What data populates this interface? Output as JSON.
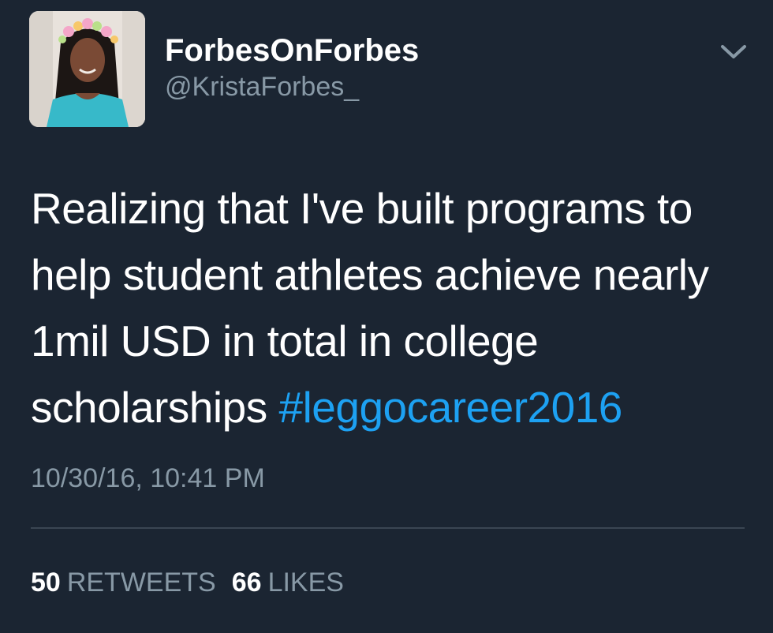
{
  "user": {
    "display_name": "ForbesOnForbes",
    "handle": "@KristaForbes_",
    "avatar_icon": "profile-photo-flower-crown"
  },
  "tweet": {
    "text": "Realizing that I've built programs to help student athletes achieve nearly 1mil USD in total in college scholarships ",
    "hashtag": "#leggocareer2016",
    "timestamp": "10/30/16, 10:41 PM"
  },
  "stats": {
    "retweets_count": "50",
    "retweets_label": "RETWEETS",
    "likes_count": "66",
    "likes_label": "LIKES"
  },
  "colors": {
    "background": "#1b2532",
    "hashtag": "#1da1f2",
    "muted": "#8899a6"
  },
  "menu_icon": "chevron-down-icon"
}
